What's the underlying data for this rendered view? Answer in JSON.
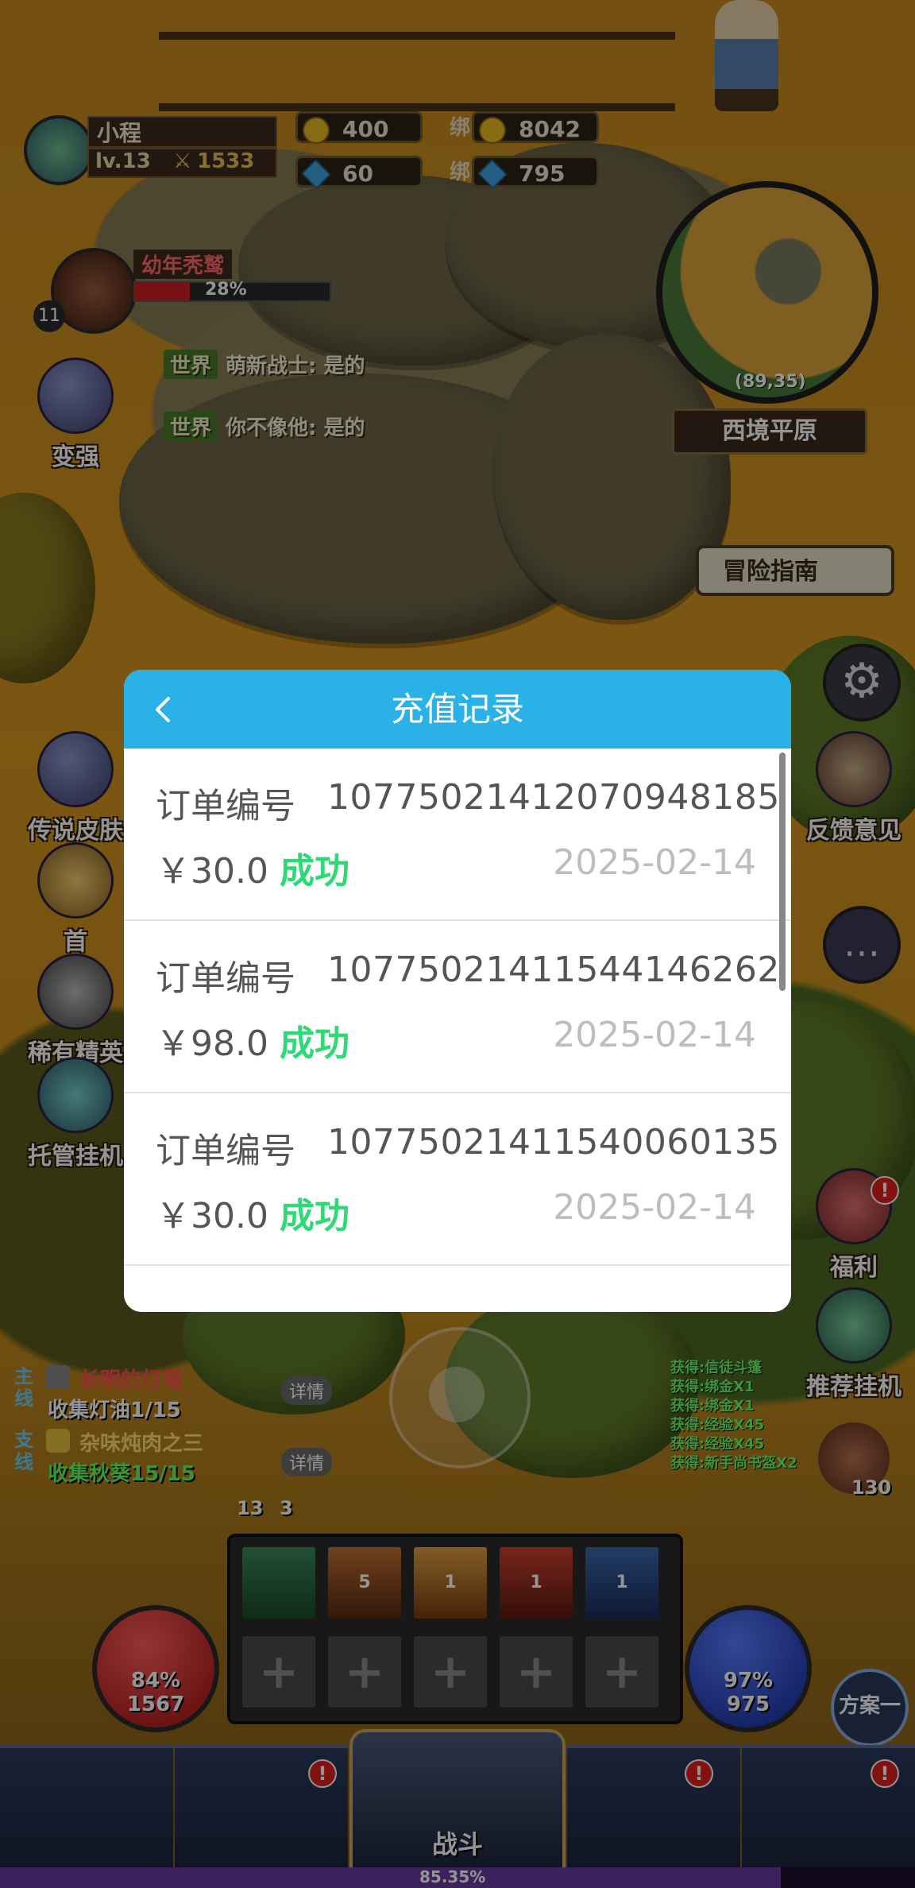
{
  "player": {
    "name": "小程",
    "level": "lv.13",
    "power": "1533"
  },
  "currency": {
    "gold": "400",
    "bound_label": "绑",
    "bound_gold": "8042",
    "diamond": "60",
    "bound_diamond": "795"
  },
  "pet": {
    "name": "幼年秃鹫",
    "progress": "28%",
    "level": "11"
  },
  "chat": [
    {
      "channel": "世界",
      "text": "萌新战士: 是的"
    },
    {
      "channel": "世界",
      "text": "你不像他: 是的"
    }
  ],
  "map": {
    "coords": "(89,35)",
    "name": "西境平原"
  },
  "buttons": {
    "strengthen": "变强",
    "guide": "冒险指南",
    "legend_skin": "传说皮肤",
    "first": "首",
    "rare_elite": "稀有精英",
    "auto_hang": "托管挂机",
    "feedback": "反馈意见",
    "welfare": "福利",
    "recommend": "推荐挂机",
    "plan": "方案一",
    "battle": "战斗"
  },
  "quests": [
    {
      "tag": "主线",
      "title": "长明的灯塔",
      "task": "收集灯油1/15",
      "detail": "详情"
    },
    {
      "tag": "支线",
      "title": "杂味炖肉之三",
      "task": "收集秋葵15/15",
      "detail": "详情"
    }
  ],
  "loot_log": [
    "获得:信徒斗篷",
    "获得:绑金X1",
    "获得:绑金X1",
    "获得:经验X45",
    "获得:经验X45",
    "获得:新手尚书盔X2"
  ],
  "hud": {
    "hp_pct": "84%",
    "hp": "1567",
    "mp_pct": "97%",
    "mp": "975",
    "exp": "85.35%",
    "bag_count": "130",
    "counter": "13",
    "counter2": "3"
  },
  "skills": [
    "",
    "5",
    "1",
    "1",
    "1"
  ],
  "modal": {
    "title": "充值记录",
    "order_label": "订单编号",
    "records": [
      {
        "order_no": "10775021412070948185",
        "amount": "￥30.0",
        "status": "成功",
        "date": "2025-02-14"
      },
      {
        "order_no": "10775021411544146262",
        "amount": "￥98.0",
        "status": "成功",
        "date": "2025-02-14"
      },
      {
        "order_no": "10775021411540060135",
        "amount": "￥30.0",
        "status": "成功",
        "date": "2025-02-14"
      }
    ]
  },
  "colors": {
    "header": "#29b1e8",
    "success": "#2fd975",
    "date": "#bdbdbd"
  }
}
